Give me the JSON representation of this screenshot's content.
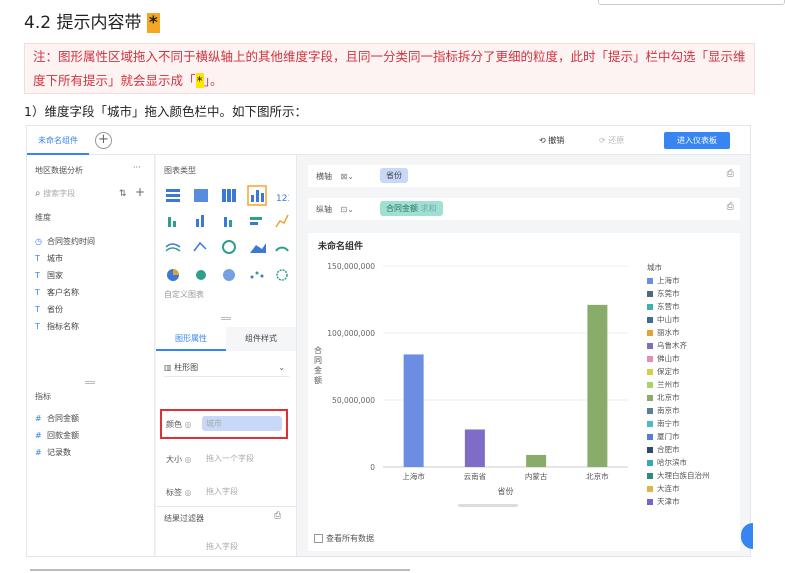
{
  "doc": {
    "heading": "4.2 提示内容带",
    "heading_star": "*",
    "note_text": "注：图形属性区域拖入不同于横纵轴上的其他维度字段，且同一分类同一指标拆分了更细的粒度，此时「提示」栏中勾选「显示维度下所有提示」就会显示成「",
    "note_star": "*",
    "note_end": "」。",
    "step1": "1）维度字段「城市」拖入颜色栏中。如下图所示："
  },
  "app": {
    "tab_name": "未命名组件",
    "add_tab": "+",
    "undo": "撤销",
    "redo": "还原",
    "enter_dashboard": "进入仪表板",
    "data_panel_title": "地区数据分析",
    "more": "···",
    "search_placeholder": "搜索字段",
    "dimension_label": "维度",
    "dimensions": [
      {
        "icon": "◷",
        "label": "合同签约时间"
      },
      {
        "icon": "T",
        "label": "城市"
      },
      {
        "icon": "T",
        "label": "国家"
      },
      {
        "icon": "T",
        "label": "客户名称"
      },
      {
        "icon": "T",
        "label": "省份"
      },
      {
        "icon": "T",
        "label": "指标名称"
      }
    ],
    "measure_label": "指标",
    "measures": [
      {
        "icon": "#",
        "label": "合同金额"
      },
      {
        "icon": "#",
        "label": "回款金额"
      },
      {
        "icon": "#",
        "label": "记录数"
      }
    ],
    "chart_type_label": "图表类型",
    "custom_chart": "自定义图表",
    "tab_shape": "图形属性",
    "tab_style": "组件样式",
    "chart_select": "柱形图",
    "prop_color": "颜色",
    "prop_color_value": "城市",
    "prop_size": "大小",
    "prop_size_value": "拖入一个字段",
    "prop_label": "标签",
    "prop_label_value": "拖入字段",
    "filter_label": "结果过滤器",
    "filter_drop": "拖入字段",
    "x_axis_label": "横轴",
    "x_axis_field": "省份",
    "y_axis_label": "纵轴",
    "y_axis_field": "合同金额",
    "y_axis_agg": "求和",
    "chart_title": "未命名组件",
    "show_all_data": "查看所有数据"
  },
  "chart_data": {
    "type": "bar",
    "title": "未命名组件",
    "xlabel": "省份",
    "ylabel": "合同金额",
    "categories": [
      "上海市",
      "云南省",
      "内蒙古",
      "北京市"
    ],
    "values": [
      84000000,
      28000000,
      9000000,
      121000000
    ],
    "bar_colors": [
      "#6b8ee3",
      "#7f6cc7",
      "#8aac6a",
      "#8aac6a"
    ],
    "ylim": [
      0,
      150000000
    ],
    "yticks": [
      0,
      50000000,
      100000000,
      150000000
    ],
    "ytick_labels": [
      "0",
      "50,000,000",
      "100,000,000",
      "150,000,000"
    ],
    "legend_title": "城市",
    "legend": [
      {
        "name": "上海市",
        "color": "#6b8ee3"
      },
      {
        "name": "东莞市",
        "color": "#4c6a86"
      },
      {
        "name": "东营市",
        "color": "#3fb2a8"
      },
      {
        "name": "中山市",
        "color": "#3f6e8a"
      },
      {
        "name": "丽水市",
        "color": "#e3a33a"
      },
      {
        "name": "乌鲁木齐",
        "color": "#7f6cc7"
      },
      {
        "name": "佛山市",
        "color": "#e58fb8"
      },
      {
        "name": "保定市",
        "color": "#d7d045"
      },
      {
        "name": "兰州市",
        "color": "#a7d36a"
      },
      {
        "name": "北京市",
        "color": "#8aac6a"
      },
      {
        "name": "南京市",
        "color": "#5a7f9b"
      },
      {
        "name": "南宁市",
        "color": "#52b7c7"
      },
      {
        "name": "厦门市",
        "color": "#4f7fd6"
      },
      {
        "name": "合肥市",
        "color": "#2f4a6b"
      },
      {
        "name": "哈尔滨市",
        "color": "#3aa7b8"
      },
      {
        "name": "大理白族自治州",
        "color": "#2a8f7a"
      },
      {
        "name": "大连市",
        "color": "#e3b24a"
      },
      {
        "name": "天津市",
        "color": "#7a62c9"
      }
    ]
  }
}
